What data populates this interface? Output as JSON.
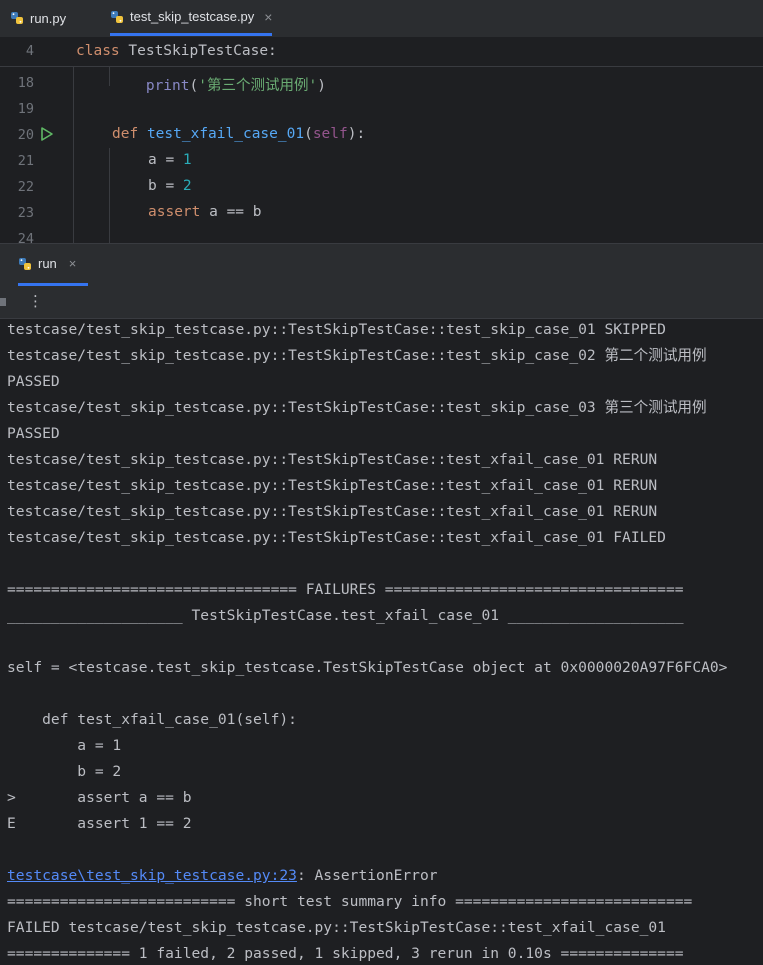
{
  "tabs": [
    {
      "label": "run.py",
      "active": false
    },
    {
      "label": "test_skip_testcase.py",
      "active": true,
      "close": "×"
    }
  ],
  "editor": {
    "sticky_line_no": "4",
    "sticky_class_kw": "class",
    "sticky_class_name": " TestSkipTestCase:",
    "lines": [
      {
        "no": "18",
        "indent": "        ",
        "print_kw": "print",
        "open": "(",
        "str": "'第三个测试用例'",
        "close": ")"
      },
      {
        "no": "19"
      },
      {
        "no": "20",
        "def": "def",
        "name": "test_xfail_case_01",
        "open": "(",
        "self": "self",
        "close": "):"
      },
      {
        "no": "21",
        "lhs": "a = ",
        "val": "1"
      },
      {
        "no": "22",
        "lhs": "b = ",
        "val": "2"
      },
      {
        "no": "23",
        "assert": "assert",
        "expr": " a == b"
      },
      {
        "no": "24"
      }
    ]
  },
  "run_window": {
    "tab_label": "run",
    "close": "×",
    "more_icon": "⋮"
  },
  "console": {
    "lines": [
      "testcase/test_skip_testcase.py::TestSkipTestCase::test_skip_case_01 SKIPPED",
      "testcase/test_skip_testcase.py::TestSkipTestCase::test_skip_case_02 第二个测试用例",
      "PASSED",
      "testcase/test_skip_testcase.py::TestSkipTestCase::test_skip_case_03 第三个测试用例",
      "PASSED",
      "testcase/test_skip_testcase.py::TestSkipTestCase::test_xfail_case_01 RERUN",
      "testcase/test_skip_testcase.py::TestSkipTestCase::test_xfail_case_01 RERUN",
      "testcase/test_skip_testcase.py::TestSkipTestCase::test_xfail_case_01 RERUN",
      "testcase/test_skip_testcase.py::TestSkipTestCase::test_xfail_case_01 FAILED",
      "",
      "================================= FAILURES ==================================",
      "____________________ TestSkipTestCase.test_xfail_case_01 ____________________",
      "",
      "self = <testcase.test_skip_testcase.TestSkipTestCase object at 0x0000020A97F6FCA0>",
      "",
      "    def test_xfail_case_01(self):",
      "        a = 1",
      "        b = 2",
      ">       assert a == b",
      "E       assert 1 == 2",
      ""
    ],
    "error_link": "testcase\\test_skip_testcase.py:23",
    "error_text": ": AssertionError",
    "summary_header": "========================== short test summary info ===========================",
    "failed_line": "FAILED testcase/test_skip_testcase.py::TestSkipTestCase::test_xfail_case_01",
    "final_line": "============== 1 failed, 2 passed, 1 skipped, 3 rerun in 0.10s =============="
  }
}
